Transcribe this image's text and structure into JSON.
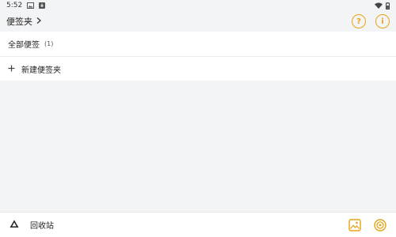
{
  "status_bar": {
    "time": "5:52",
    "icons": [
      "image-icon",
      "download-icon",
      "wifi-icon",
      "battery-icon"
    ]
  },
  "header": {
    "folder_title": "便签夹",
    "help_icon_glyph": "?",
    "info_icon_glyph": "i"
  },
  "list": {
    "all_notes_label": "全部便签",
    "all_notes_count": "(1)",
    "new_folder_label": "新建便签夹"
  },
  "bottom_bar": {
    "trash_label": "回收站"
  },
  "colors": {
    "accent": "#e8a316",
    "background": "#f3f4f5",
    "surface": "#ffffff"
  }
}
